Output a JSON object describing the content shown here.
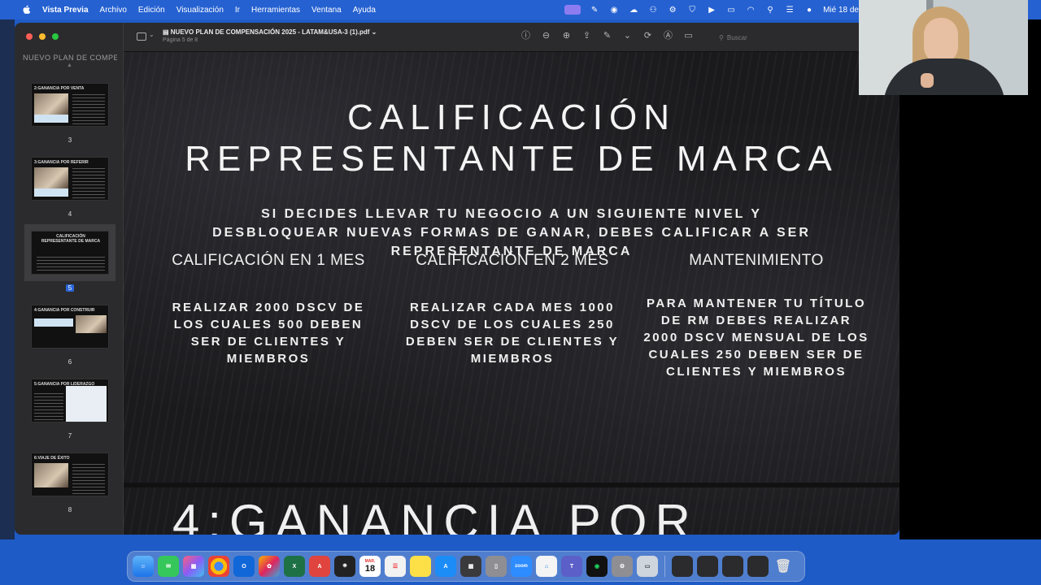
{
  "menubar": {
    "app_name": "Vista Previa",
    "items": [
      "Archivo",
      "Edición",
      "Visualización",
      "Ir",
      "Herramientas",
      "Ventana",
      "Ayuda"
    ],
    "clock": "Mié 18 de"
  },
  "sidebar": {
    "title": "NUEVO PLAN DE COMPE...",
    "thumbnails": [
      {
        "label": "2:GANANCIA POR VENTA",
        "page": "3"
      },
      {
        "label": "3:GANANCIA POR REFERIR",
        "page": "4"
      },
      {
        "label": "CALIFICACIÓN REPRESENTANTE DE MARCA",
        "page": "5",
        "selected": true
      },
      {
        "label": "4:GANANCIA POR CONSTRUIR",
        "page": "6"
      },
      {
        "label": "5:GANANCIA POR LIDERAZGO",
        "page": "7"
      },
      {
        "label": "6:VIAJE DE ÉXITO",
        "page": "8"
      }
    ]
  },
  "toolbar": {
    "doc_title": "NUEVO PLAN DE COMPENSACIÓN 2025 - LATAM&USA-3 (1).pdf",
    "page_indicator": "Página 5 de 8",
    "search_placeholder": "Buscar"
  },
  "slide": {
    "title_line1": "CALIFICACIÓN",
    "title_line2": "REPRESENTANTE DE MARCA",
    "intro": "SI DECIDES LLEVAR TU NEGOCIO A UN SIGUIENTE NIVEL Y DESBLOQUEAR NUEVAS FORMAS DE GANAR, DEBES CALIFICAR A SER REPRESENTANTE DE MARCA",
    "columns": [
      {
        "heading": "CALIFICACIÓN EN 1 MES",
        "body": "REALIZAR 2000 DSCV DE LOS CUALES 500 DEBEN SER DE CLIENTES Y MIEMBROS"
      },
      {
        "heading": "CALIFICACIÓN EN 2 MES",
        "body": "REALIZAR CADA MES 1000 DSCV DE LOS CUALES 250 DEBEN SER DE CLIENTES Y MIEMBROS"
      },
      {
        "heading": "MANTENIMIENTO",
        "body": "PARA MANTENER TU TÍTULO DE RM DEBES REALIZAR 2000 DSCV MENSUAL DE LOS CUALES 250 DEBEN SER DE CLIENTES Y MIEMBROS"
      }
    ],
    "next_page_title": "4:GANANCIA POR"
  },
  "dock": {
    "calendar_month": "MAR.",
    "calendar_day": "18",
    "zoom_label": "zoom"
  },
  "colors": {
    "menubar_bg": "#2561d1",
    "slide_bg": "#1a1a1d",
    "selection_accent": "#2a66d9"
  }
}
